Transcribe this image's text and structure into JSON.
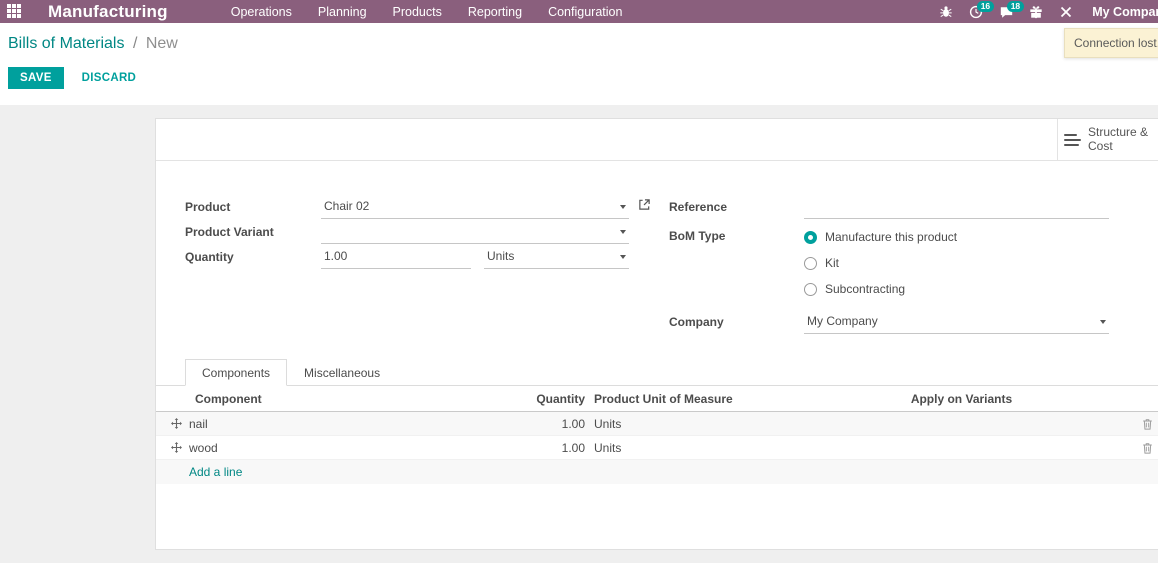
{
  "topbar": {
    "app_name": "Manufacturing",
    "menus": [
      "Operations",
      "Planning",
      "Products",
      "Reporting",
      "Configuration"
    ],
    "activity_count": "16",
    "message_count": "18",
    "user": "My Company",
    "colors": {
      "bg": "#8A5F7D",
      "badge": "#00A09D"
    }
  },
  "toast": {
    "text": "Connection lost."
  },
  "breadcrumb": {
    "parent": "Bills of Materials",
    "separator": "/",
    "current": "New"
  },
  "actions": {
    "save": "SAVE",
    "discard": "DISCARD"
  },
  "sheet": {
    "smart_button": {
      "label_line1": "Structure &",
      "label_line2": "Cost"
    },
    "fields": {
      "product": {
        "label": "Product",
        "value": "Chair 02"
      },
      "product_variant": {
        "label": "Product Variant",
        "value": ""
      },
      "quantity": {
        "label": "Quantity",
        "value": "1.00",
        "uom": "Units"
      },
      "reference": {
        "label": "Reference",
        "value": ""
      },
      "bom_type": {
        "label": "BoM Type",
        "options": [
          {
            "label": "Manufacture this product",
            "selected": true
          },
          {
            "label": "Kit",
            "selected": false
          },
          {
            "label": "Subcontracting",
            "selected": false
          }
        ]
      },
      "company": {
        "label": "Company",
        "value": "My Company"
      }
    },
    "tabs": [
      {
        "label": "Components",
        "active": true
      },
      {
        "label": "Miscellaneous",
        "active": false
      }
    ],
    "table": {
      "headers": [
        "Component",
        "Quantity",
        "Product Unit of Measure",
        "Apply on Variants"
      ],
      "rows": [
        {
          "component": "nail",
          "quantity": "1.00",
          "uom": "Units"
        },
        {
          "component": "wood",
          "quantity": "1.00",
          "uom": "Units"
        }
      ],
      "add_line": "Add a line"
    },
    "accent": "#00A09D"
  }
}
